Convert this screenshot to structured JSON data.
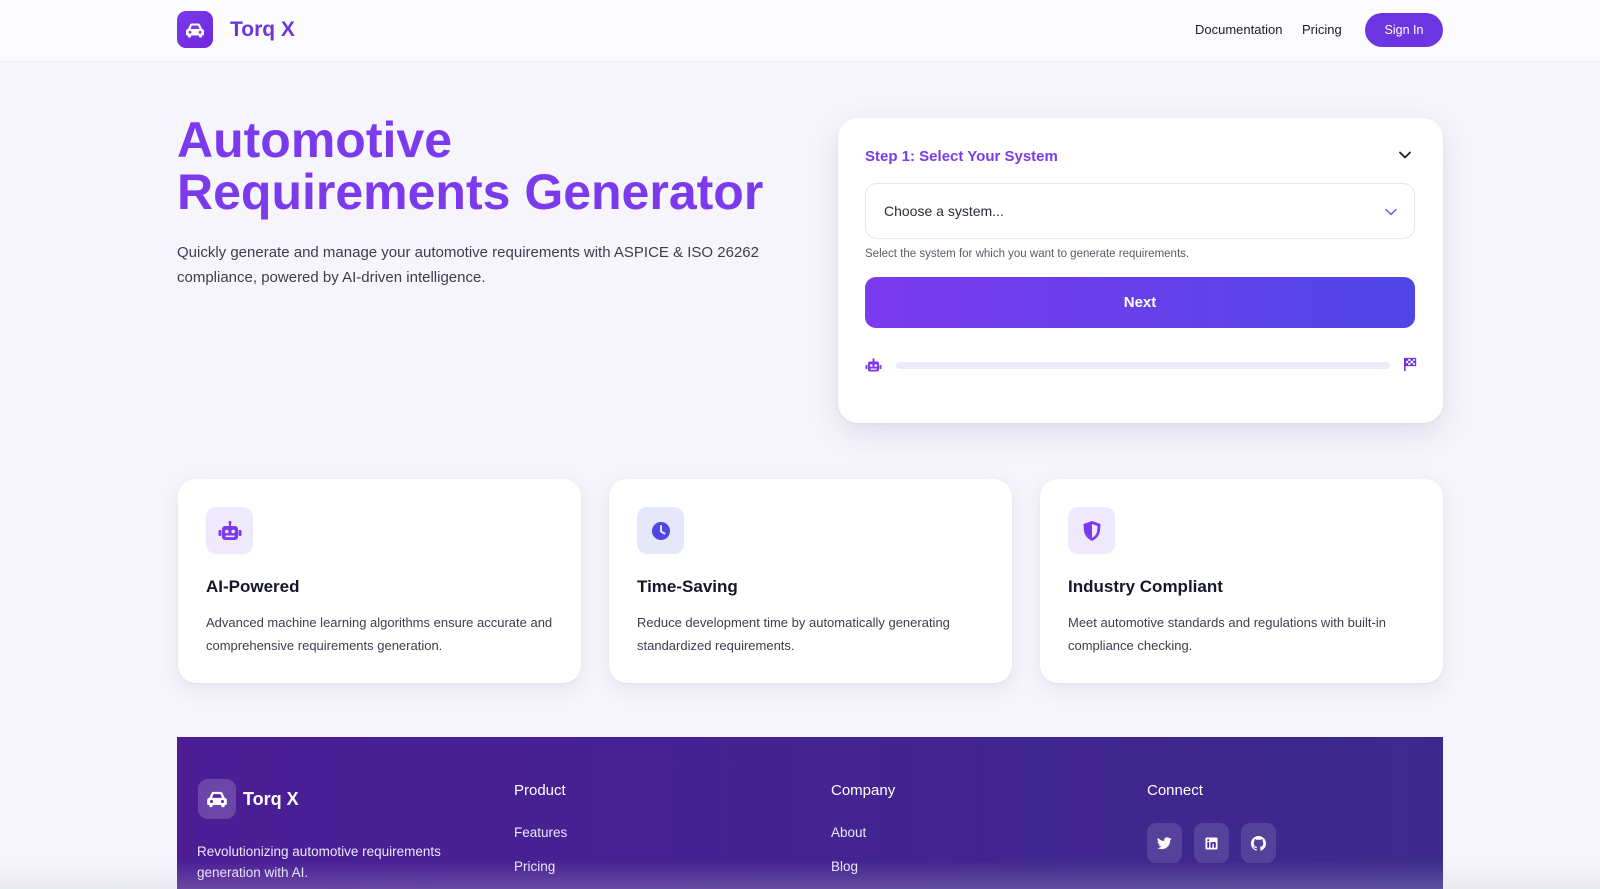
{
  "header": {
    "brand": "Torq X",
    "nav": [
      "Documentation",
      "Pricing"
    ],
    "signin_label": "Sign In"
  },
  "hero": {
    "title_line1": "Automotive",
    "title_line2": "Requirements Generator",
    "subtitle": "Quickly generate and manage your automotive requirements with ASPICE & ISO 26262 compliance, powered by AI-driven intelligence."
  },
  "step": {
    "title": "Step 1: Select Your System",
    "select_placeholder": "Choose a system...",
    "help": "Select the system for which you want to generate requirements.",
    "next_label": "Next",
    "progress": 0
  },
  "features": [
    {
      "icon": "robot-icon",
      "title": "AI-Powered",
      "desc": "Advanced machine learning algorithms ensure accurate and comprehensive requirements generation."
    },
    {
      "icon": "clock-icon",
      "title": "Time-Saving",
      "desc": "Reduce development time by automatically generating standardized requirements."
    },
    {
      "icon": "shield-icon",
      "title": "Industry Compliant",
      "desc": "Meet automotive standards and regulations with built-in compliance checking."
    }
  ],
  "footer": {
    "brand": "Torq X",
    "tagline": "Revolutionizing automotive requirements generation with AI.",
    "product": {
      "heading": "Product",
      "links": [
        "Features",
        "Pricing"
      ]
    },
    "company": {
      "heading": "Company",
      "links": [
        "About",
        "Blog"
      ]
    },
    "connect": {
      "heading": "Connect",
      "icons": [
        "twitter-icon",
        "linkedin-icon",
        "github-icon"
      ]
    }
  },
  "colors": {
    "accent": "#7c3aed",
    "accent_dark": "#6d35e0",
    "footer_bg": "#4c1d95"
  }
}
